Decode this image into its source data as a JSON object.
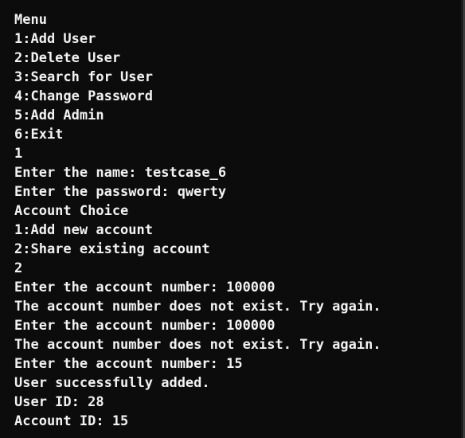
{
  "terminal": {
    "background_color": "#0c0c0c",
    "text_color": "#f2f2f2",
    "lines": [
      "Menu",
      "1:Add User",
      "2:Delete User",
      "3:Search for User",
      "4:Change Password",
      "5:Add Admin",
      "6:Exit",
      "1",
      "Enter the name: testcase_6",
      "Enter the password: qwerty",
      "Account Choice",
      "1:Add new account",
      "2:Share existing account",
      "2",
      "Enter the account number: 100000",
      "The account number does not exist. Try again.",
      "Enter the account number: 100000",
      "The account number does not exist. Try again.",
      "Enter the account number: 15",
      "User successfully added.",
      "User ID: 28",
      "Account ID: 15"
    ]
  }
}
